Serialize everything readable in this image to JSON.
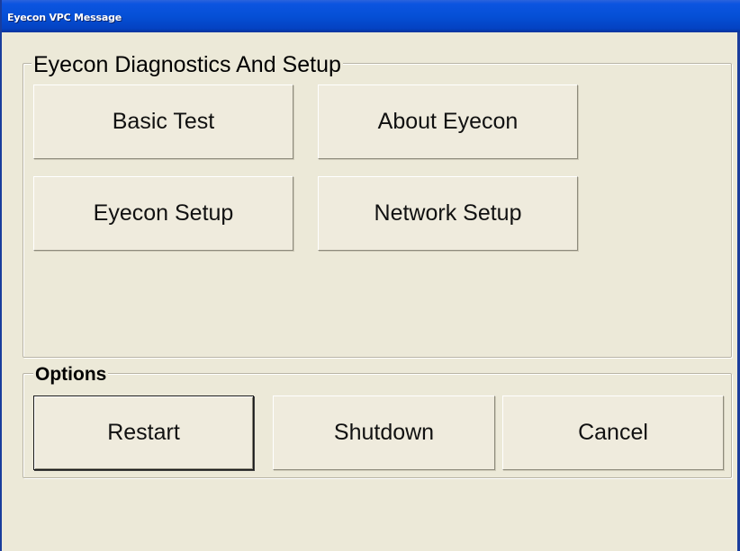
{
  "window": {
    "title": "Eyecon VPC Message"
  },
  "diagnostics": {
    "legend": "Eyecon Diagnostics And Setup",
    "buttons": {
      "basic_test": "Basic Test",
      "about_eyecon": "About Eyecon",
      "eyecon_setup": "Eyecon Setup",
      "network_setup": "Network Setup"
    }
  },
  "options": {
    "legend": "Options",
    "buttons": {
      "restart": "Restart",
      "shutdown": "Shutdown",
      "cancel": "Cancel"
    }
  },
  "colors": {
    "title_bar": "#0550d6",
    "window_face": "#ece9d8",
    "button_face": "#efebdd"
  }
}
